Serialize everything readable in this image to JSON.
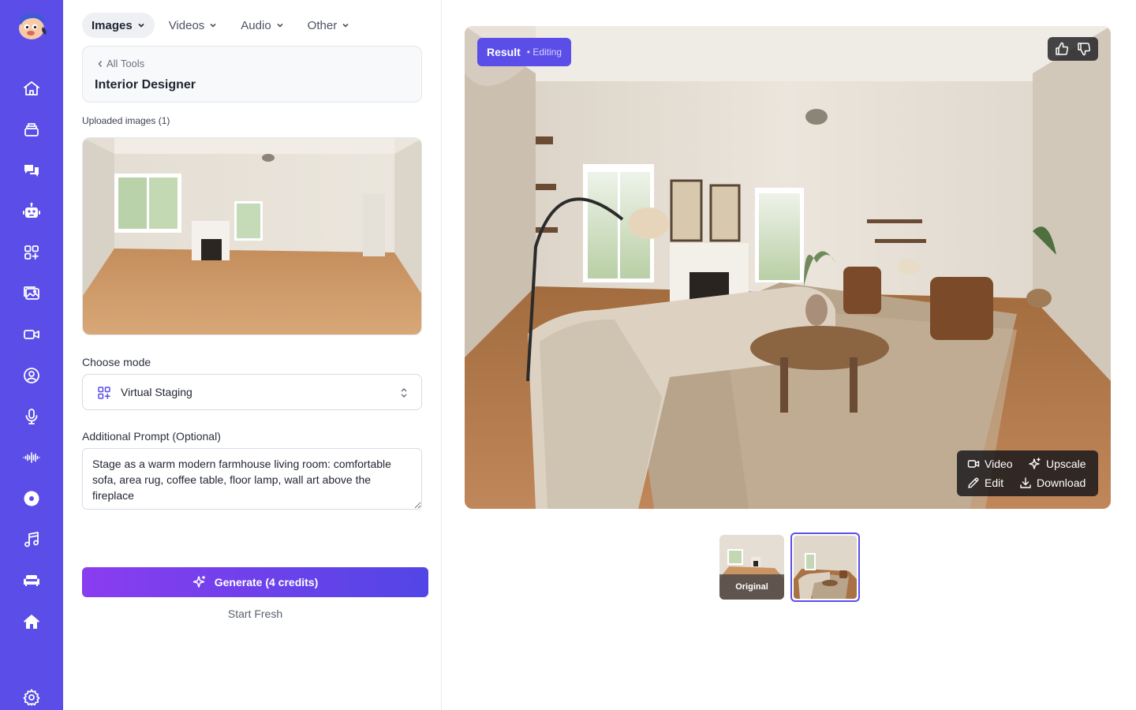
{
  "sidebar": {
    "items": [
      {
        "name": "home",
        "icon": "home-icon"
      },
      {
        "name": "library",
        "icon": "stack-icon"
      },
      {
        "name": "chat",
        "icon": "chat-icon"
      },
      {
        "name": "assistants",
        "icon": "robot-icon"
      },
      {
        "name": "apps",
        "icon": "apps-icon"
      },
      {
        "name": "images",
        "icon": "image-gallery-icon"
      },
      {
        "name": "video",
        "icon": "video-camera-icon"
      },
      {
        "name": "avatar",
        "icon": "user-circle-icon"
      },
      {
        "name": "microphone",
        "icon": "microphone-icon"
      },
      {
        "name": "audio-wave",
        "icon": "waveform-icon"
      },
      {
        "name": "disc",
        "icon": "disc-icon"
      },
      {
        "name": "music",
        "icon": "music-note-icon"
      },
      {
        "name": "sofa",
        "icon": "sofa-icon"
      },
      {
        "name": "house",
        "icon": "house-icon"
      },
      {
        "name": "settings",
        "icon": "gear-icon"
      }
    ],
    "accent": "#5b4ee8"
  },
  "categories": [
    {
      "label": "Images",
      "active": true
    },
    {
      "label": "Videos",
      "active": false
    },
    {
      "label": "Audio",
      "active": false
    },
    {
      "label": "Other",
      "active": false
    }
  ],
  "tool": {
    "back_label": "All Tools",
    "title": "Interior Designer"
  },
  "uploaded": {
    "label": "Uploaded images (1)"
  },
  "mode": {
    "label": "Choose mode",
    "value": "Virtual Staging"
  },
  "prompt": {
    "label": "Additional Prompt (Optional)",
    "value": "Stage as a warm modern farmhouse living room: comfortable sofa, area rug, coffee table, floor lamp, wall art above the fireplace"
  },
  "generate": {
    "label": "Generate (4 credits)"
  },
  "start_fresh": "Start Fresh",
  "result": {
    "title": "Result",
    "status": "• Editing",
    "actions": {
      "video": "Video",
      "upscale": "Upscale",
      "edit": "Edit",
      "download": "Download"
    }
  },
  "thumbnails": [
    {
      "label": "Original",
      "selected": false
    },
    {
      "label": "",
      "selected": true
    }
  ]
}
